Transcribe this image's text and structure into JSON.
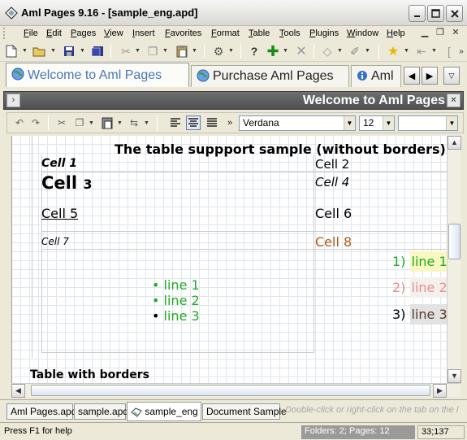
{
  "window": {
    "title": "Aml Pages 9.16 - [sample_eng.apd]",
    "controls": [
      "minimize",
      "maximize",
      "close"
    ]
  },
  "menubar": {
    "items": [
      "File",
      "Edit",
      "Pages",
      "View",
      "Insert",
      "Favorites",
      "Format",
      "Table",
      "Tools",
      "Plugins",
      "Window",
      "Help"
    ],
    "mdi_controls": [
      "minimize",
      "restore",
      "close"
    ]
  },
  "toolbar": {
    "buttons": [
      "new-page",
      "open",
      "save",
      "save-all",
      "cut",
      "copy",
      "paste",
      "print",
      "help",
      "add",
      "delete",
      "tag",
      "dropper",
      "favorite",
      "back",
      "forward"
    ]
  },
  "page_tabs": {
    "tabs": [
      {
        "label": "Welcome to Aml Pages",
        "icon": "globe-icon",
        "active": true
      },
      {
        "label": "Purchase Aml Pages",
        "icon": "globe-icon",
        "active": false
      },
      {
        "label": "Aml",
        "icon": "info-icon",
        "active": false
      }
    ]
  },
  "header": {
    "title": "Welcome to Aml Pages"
  },
  "format_toolbar": {
    "font": "Verdana",
    "size": "12"
  },
  "document": {
    "table1_title": "The table suppport sample (without borders)",
    "cells": {
      "c1": "Cell 1",
      "c2": "Cell 2",
      "c3": "Cell",
      "c3_num": "3",
      "c4": "Cell 4",
      "c5": "Cell 5",
      "c6": "Cell 6",
      "c7": "Cell 7",
      "c8": "Cell 8"
    },
    "bullets": [
      "line 1",
      "line 2",
      "line 3"
    ],
    "numbered": [
      {
        "num": "1)",
        "text": "line 1"
      },
      {
        "num": "2)",
        "text": "line 2"
      },
      {
        "num": "3)",
        "text": "line 3"
      }
    ],
    "table2_title": "Table with borders"
  },
  "doc_tabs": {
    "tabs": [
      {
        "label": "Aml Pages.apd",
        "active": false
      },
      {
        "label": "sample.apd",
        "active": false
      },
      {
        "label": "sample_eng",
        "active": true
      },
      {
        "label": "Document Sample",
        "active": false
      }
    ],
    "hint": "Double-click or right-click on the tab on the l"
  },
  "statusbar": {
    "help": "Press F1 for help",
    "counts": "Folders: 2; Pages: 12",
    "position": "33;137"
  },
  "colors": {
    "active_tab_text": "#4b77b7",
    "green": "#22aa22",
    "brown": "#b05a1a",
    "pink": "#e8908c",
    "yellow_bg": "#f8f8c0",
    "pink_bg": "#f4f0ee",
    "gray_bg": "#e2e2e2"
  }
}
